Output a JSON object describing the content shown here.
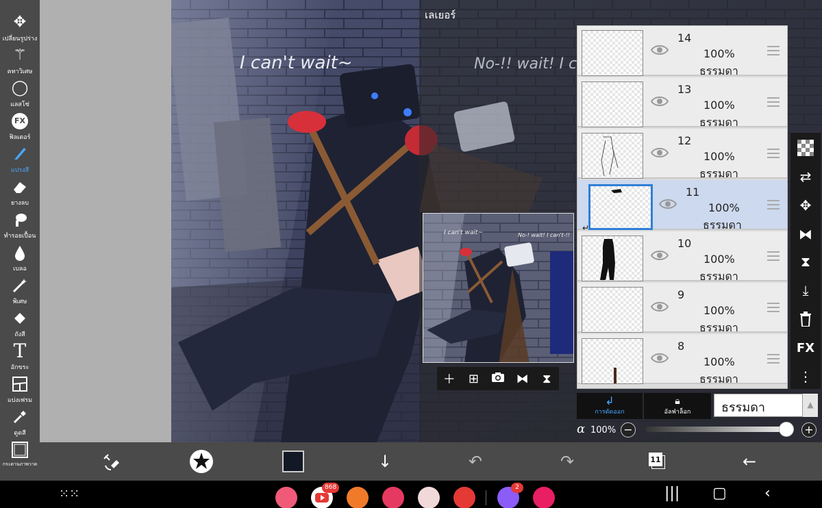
{
  "left_toolbar": {
    "tools": [
      {
        "label": "เปลี่ยนรูปร่าง",
        "icon": "move-icon",
        "glyph": "✥"
      },
      {
        "label": "คทาวิเศษ",
        "icon": "magic-wand-icon",
        "glyph": "⚚"
      },
      {
        "label": "แลสโซ่",
        "icon": "lasso-icon",
        "glyph": "◯"
      },
      {
        "label": "ฟิลเตอร์",
        "icon": "fx-filter-icon",
        "glyph": "FX"
      },
      {
        "label": "แปรงสี",
        "icon": "brush-icon",
        "glyph": "╱"
      },
      {
        "label": "ยางลบ",
        "icon": "eraser-icon",
        "glyph": "▰"
      },
      {
        "label": "ทำรอยเปื้อน",
        "icon": "smudge-icon",
        "glyph": "☝"
      },
      {
        "label": "เบลอ",
        "icon": "blur-drop-icon",
        "glyph": "💧"
      },
      {
        "label": "พิเศษ",
        "icon": "special-wand-icon",
        "glyph": "✦"
      },
      {
        "label": "ถังสี",
        "icon": "bucket-icon",
        "glyph": "◆"
      },
      {
        "label": "อักขระ",
        "icon": "text-icon",
        "glyph": "T"
      },
      {
        "label": "แบ่งเฟรม",
        "icon": "frame-divider-icon",
        "glyph": "▦"
      },
      {
        "label": "ดูดสี",
        "icon": "eyedropper-icon",
        "glyph": "✎"
      },
      {
        "label": "กระดานภาพวาด",
        "icon": "canvas-board-icon",
        "glyph": "▢"
      }
    ],
    "active_index": 4
  },
  "artwork": {
    "text_left": "I can't wait~",
    "text_right": "No-!! wait! I c",
    "preview_text_left": "I can't wait~",
    "preview_text_right": "No-! wait! I can't-!!"
  },
  "layer_panel": {
    "title": "เลเยอร์",
    "layers": [
      {
        "number": "14",
        "opacity": "100%",
        "mode": "ธรรมดา",
        "selected": false
      },
      {
        "number": "13",
        "opacity": "100%",
        "mode": "ธรรมดา",
        "selected": false
      },
      {
        "number": "12",
        "opacity": "100%",
        "mode": "ธรรมดา",
        "selected": false
      },
      {
        "number": "11",
        "opacity": "100%",
        "mode": "ธรรมดา",
        "selected": true
      },
      {
        "number": "10",
        "opacity": "100%",
        "mode": "ธรรมดา",
        "selected": false
      },
      {
        "number": "9",
        "opacity": "100%",
        "mode": "ธรรมดา",
        "selected": false
      },
      {
        "number": "8",
        "opacity": "100%",
        "mode": "ธรรมดา",
        "selected": false
      }
    ],
    "clipping_label": "การตัดออก",
    "alpha_lock_label": "อัลฟ่าล็อก",
    "blend_mode": "ธรรมดา",
    "opacity_symbol": "α",
    "opacity_value": "100%",
    "opacity_fraction": 1.0,
    "right_icons": [
      "checker-icon",
      "transfer-icon",
      "move-icon",
      "flip-horizontal-icon",
      "flip-vertical-icon",
      "merge-down-icon",
      "trash-icon",
      "fx-icon",
      "more-icon"
    ],
    "fx_label": "FX",
    "preview_tools": [
      "add-layer-icon",
      "add-copy-icon",
      "camera-icon",
      "flip-h-icon",
      "flip-v-icon"
    ]
  },
  "bottom_bar": {
    "layer_count": "11",
    "icons": [
      "transform-swap-icon",
      "brush-preset-icon",
      "color-swatch",
      "download-icon",
      "undo-icon",
      "redo-icon",
      "layers-icon",
      "back-arrow-icon"
    ],
    "color_swatch": "#121826"
  },
  "nav_bar": {
    "badges": {
      "youtube": "868",
      "messenger": "2"
    }
  },
  "colors": {
    "accent": "#4aa6ff",
    "selected_row": "#cdd9ee",
    "toolbar": "#4a4a4a"
  }
}
